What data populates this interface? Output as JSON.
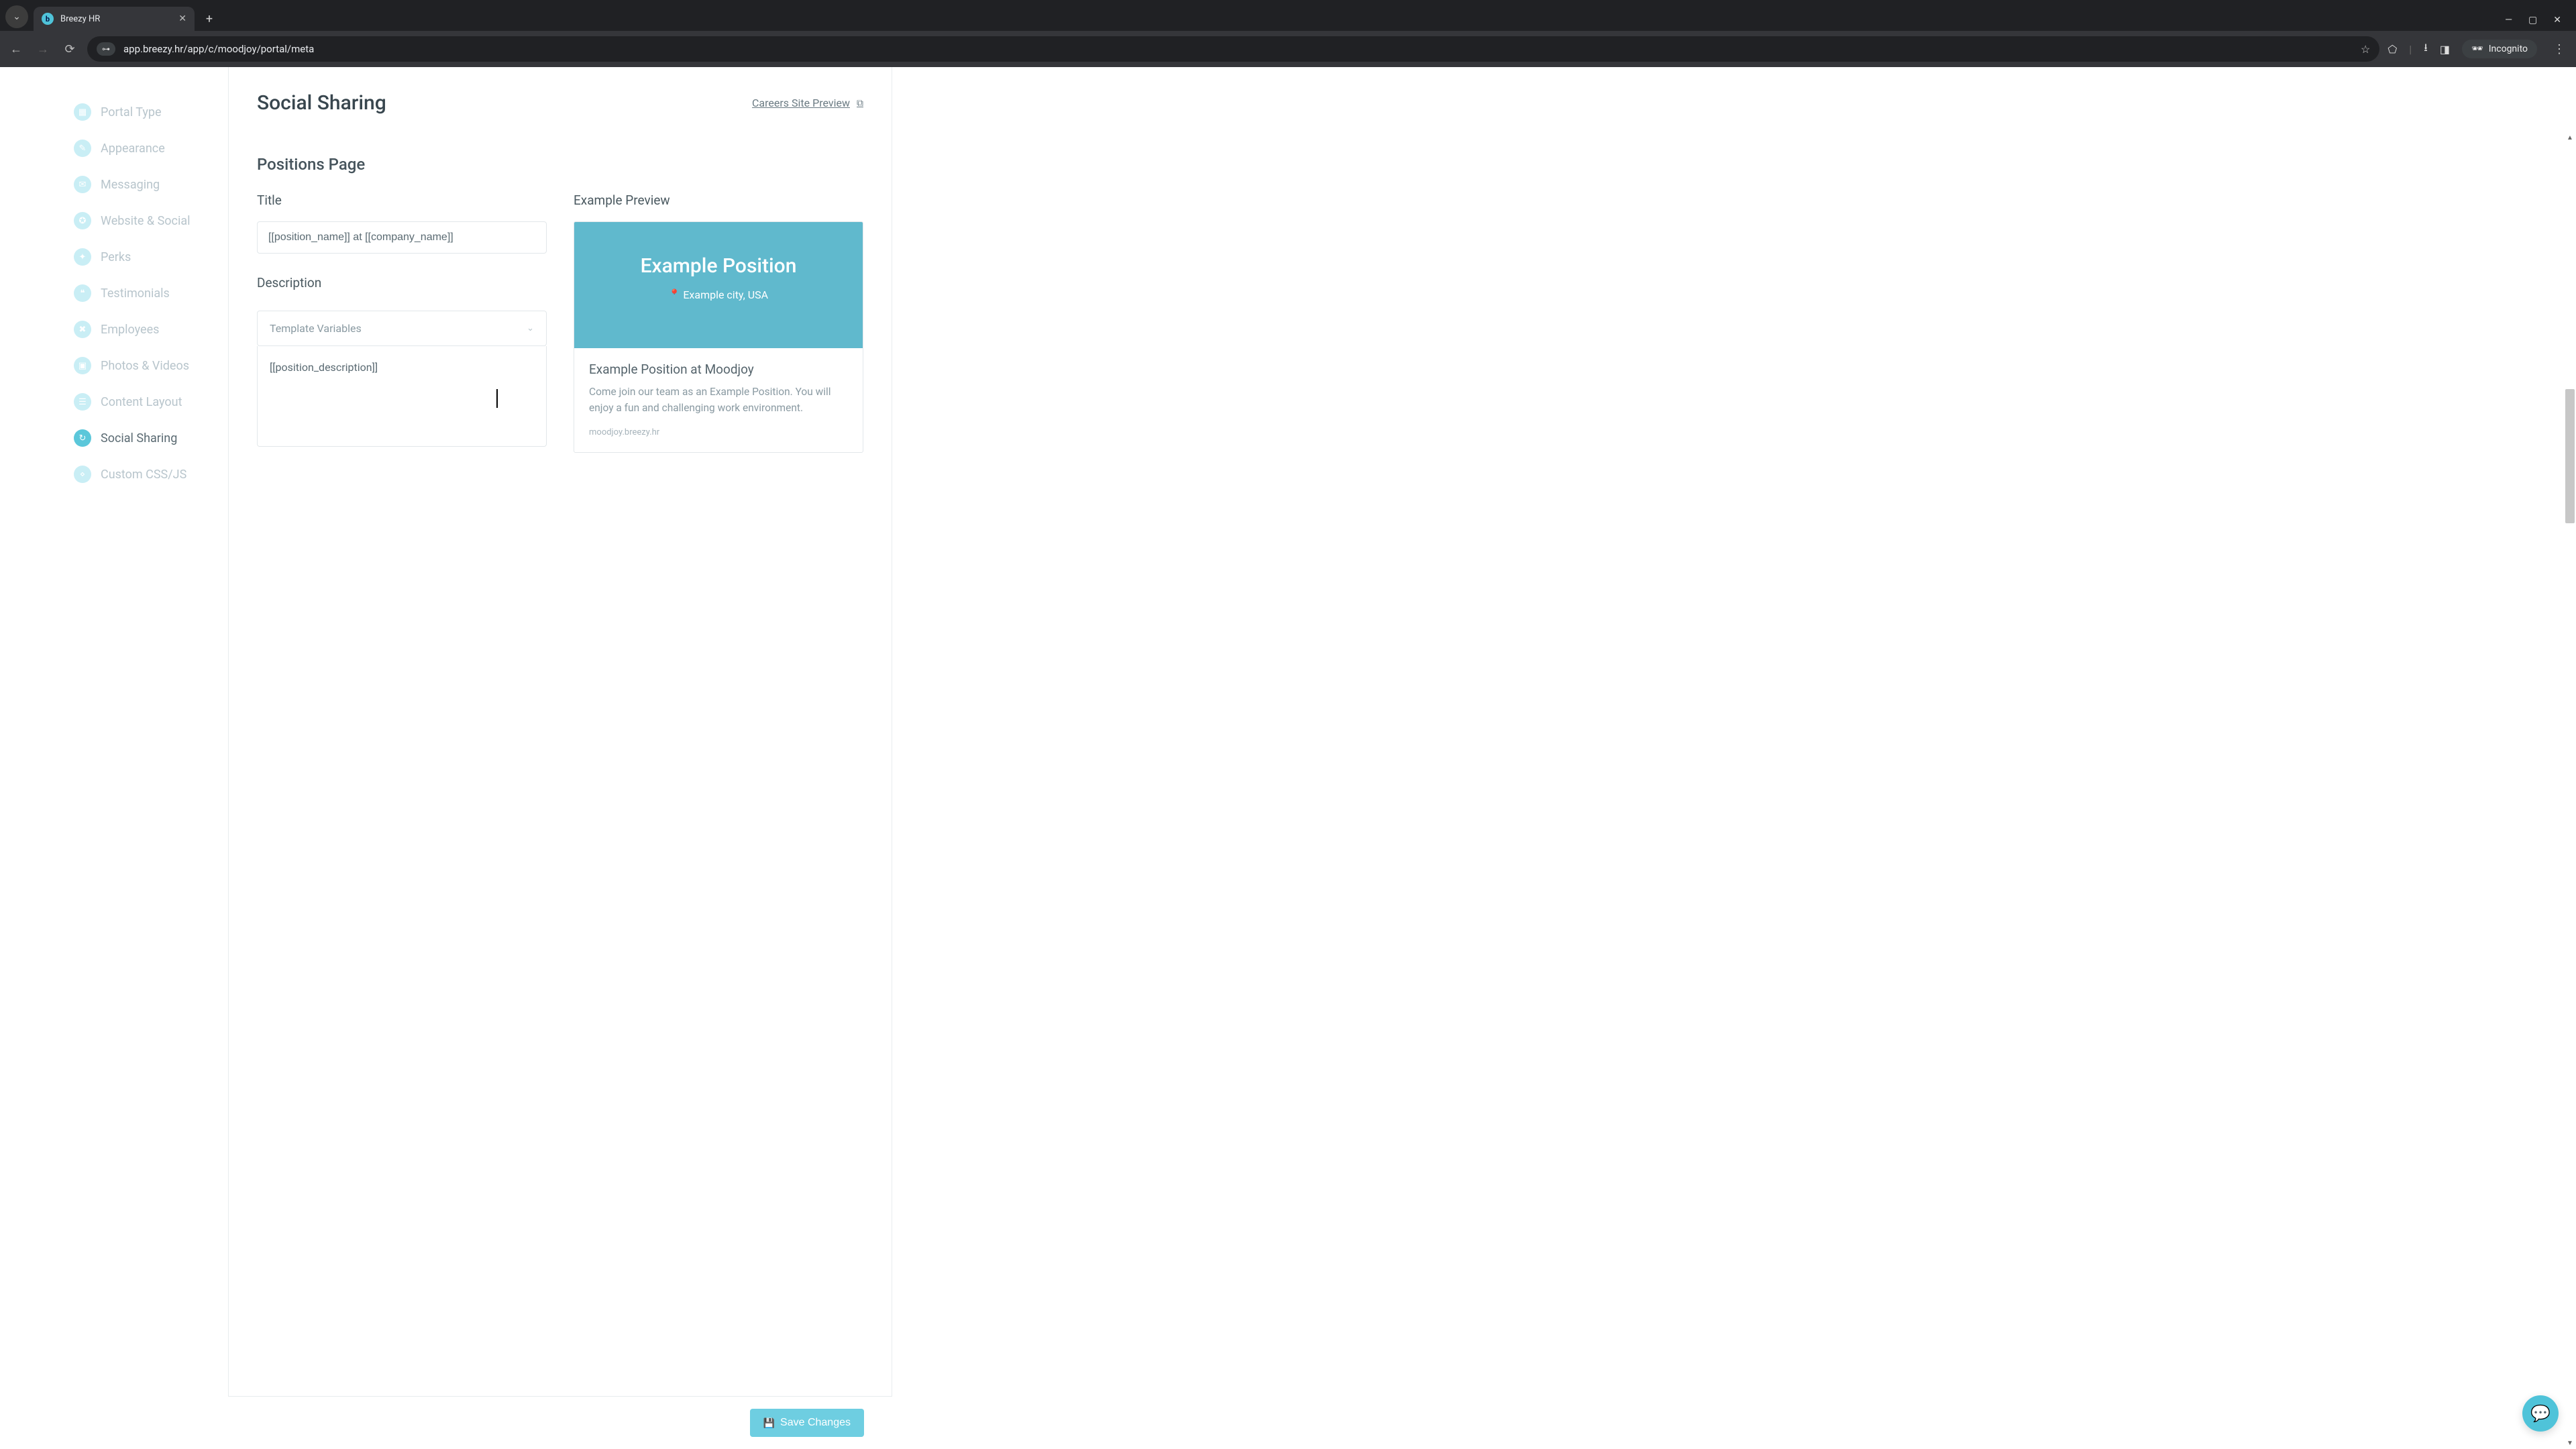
{
  "browser": {
    "tab_title": "Breezy HR",
    "url": "app.breezy.hr/app/c/moodjoy/portal/meta",
    "incognito_label": "Incognito"
  },
  "sidebar": {
    "items": [
      {
        "label": "Portal Type",
        "icon": "layout"
      },
      {
        "label": "Appearance",
        "icon": "brush"
      },
      {
        "label": "Messaging",
        "icon": "chat"
      },
      {
        "label": "Website & Social",
        "icon": "share"
      },
      {
        "label": "Perks",
        "icon": "gift"
      },
      {
        "label": "Testimonials",
        "icon": "quote"
      },
      {
        "label": "Employees",
        "icon": "user"
      },
      {
        "label": "Photos & Videos",
        "icon": "image"
      },
      {
        "label": "Content Layout",
        "icon": "grid"
      },
      {
        "label": "Social Sharing",
        "icon": "link",
        "active": true
      },
      {
        "label": "Custom CSS/JS",
        "icon": "code"
      }
    ]
  },
  "page": {
    "title": "Social Sharing",
    "preview_link": "Careers Site Preview"
  },
  "section": {
    "heading": "Positions Page",
    "title_label": "Title",
    "title_value": "[[position_name]] at [[company_name]]",
    "description_label": "Description",
    "template_vars_label": "Template Variables",
    "description_value": "[[position_description]]",
    "example_label": "Example Preview"
  },
  "preview": {
    "hero_title": "Example Position",
    "hero_location": "Example city, USA",
    "card_title": "Example Position at Moodjoy",
    "card_desc": "Come join our team as an Example Position. You will enjoy a fun and challenging work environment.",
    "card_domain": "moodjoy.breezy.hr"
  },
  "footer": {
    "save_label": "Save Changes"
  }
}
